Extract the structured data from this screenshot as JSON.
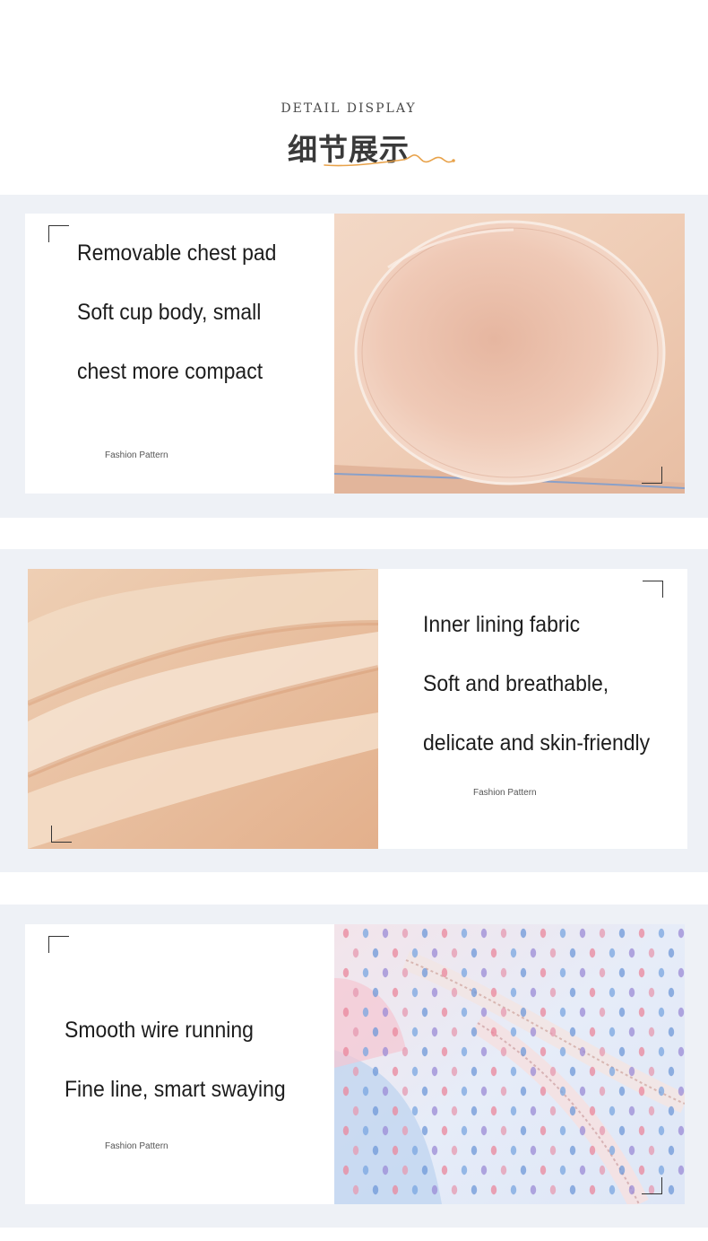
{
  "header": {
    "subtitle_en": "DETAIL DISPLAY",
    "title_zh": "细节展示"
  },
  "sections": [
    {
      "lines": [
        "Removable chest pad",
        "Soft cup body, small",
        "chest more compact"
      ],
      "tag": "Fashion Pattern",
      "image_icon": "chest-pad-photo"
    },
    {
      "lines": [
        "Inner lining fabric",
        "Soft and breathable,",
        "delicate and skin-friendly"
      ],
      "tag": "Fashion Pattern",
      "image_icon": "lining-fabric-photo"
    },
    {
      "lines": [
        "Smooth wire running",
        "Fine line, smart swaying"
      ],
      "tag": "Fashion Pattern",
      "image_icon": "mesh-fabric-photo"
    }
  ],
  "colors": {
    "band": "#eef1f6",
    "accent_squiggle": "#e8a24a",
    "skin": "#e9b896"
  }
}
